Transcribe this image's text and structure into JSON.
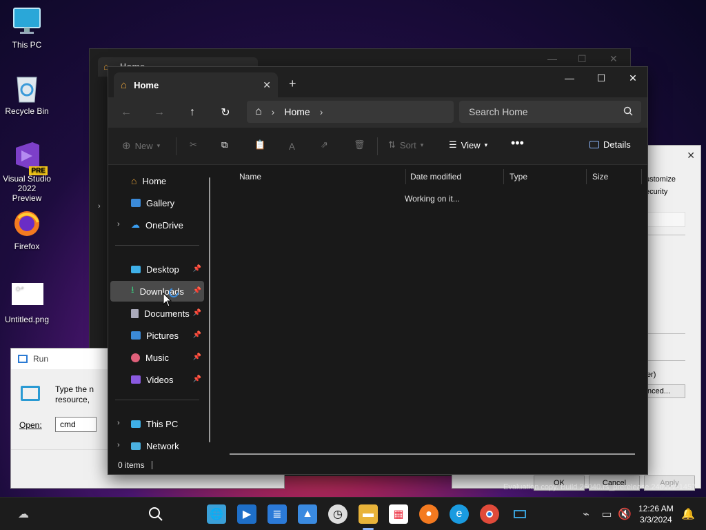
{
  "desktop": {
    "icons": [
      {
        "label": "This PC"
      },
      {
        "label": "Recycle Bin"
      },
      {
        "label": "Visual Studio\n2022 Preview",
        "line1": "Visual Studio",
        "line2": "2022 Preview",
        "badge": "PRE"
      },
      {
        "label": "Firefox"
      },
      {
        "label": "Untitled.png"
      }
    ],
    "watermark": "Evaluation copy. Build 26040.rs_prerelease.240122-1457"
  },
  "ghost_window": {
    "tab_title": "Home"
  },
  "run_dialog": {
    "title": "Run",
    "description_line1": "Type the n",
    "description_line2": "resource, ",
    "open_label": "Open:",
    "open_value": "cmd"
  },
  "props_dialog": {
    "item_customize": "ustomize",
    "item_security": "ecurity",
    "text_er": "er)",
    "btn_advanced": "nced...",
    "ok": "OK",
    "cancel": "Cancel",
    "apply": "Apply"
  },
  "explorer": {
    "tab_title": "Home",
    "address": {
      "crumb": "Home"
    },
    "search_placeholder": "Search Home",
    "commands": {
      "new": "New",
      "sort": "Sort",
      "view": "View",
      "details": "Details"
    },
    "sidebar": {
      "top": [
        {
          "label": "Home",
          "icon": "home-icon"
        },
        {
          "label": "Gallery",
          "icon": "gallery-icon"
        },
        {
          "label": "OneDrive",
          "icon": "onedrive-icon"
        }
      ],
      "pinned": [
        {
          "label": "Desktop",
          "icon": "desktop-icon"
        },
        {
          "label": "Downloads",
          "icon": "downloads-icon"
        },
        {
          "label": "Documents",
          "icon": "documents-icon"
        },
        {
          "label": "Pictures",
          "icon": "pictures-icon"
        },
        {
          "label": "Music",
          "icon": "music-icon"
        },
        {
          "label": "Videos",
          "icon": "videos-icon"
        }
      ],
      "bottom": [
        {
          "label": "This PC",
          "icon": "this-pc-icon"
        },
        {
          "label": "Network",
          "icon": "network-icon"
        }
      ]
    },
    "columns": [
      "Name",
      "Date modified",
      "Type",
      "Size"
    ],
    "loading_text": "Working on it...",
    "status": "0 items"
  },
  "taskbar": {
    "time": "12:26 AM",
    "date": "3/3/2024"
  },
  "colors": {
    "explorer_bg": "#191919",
    "accent": "#8ab4f8"
  }
}
